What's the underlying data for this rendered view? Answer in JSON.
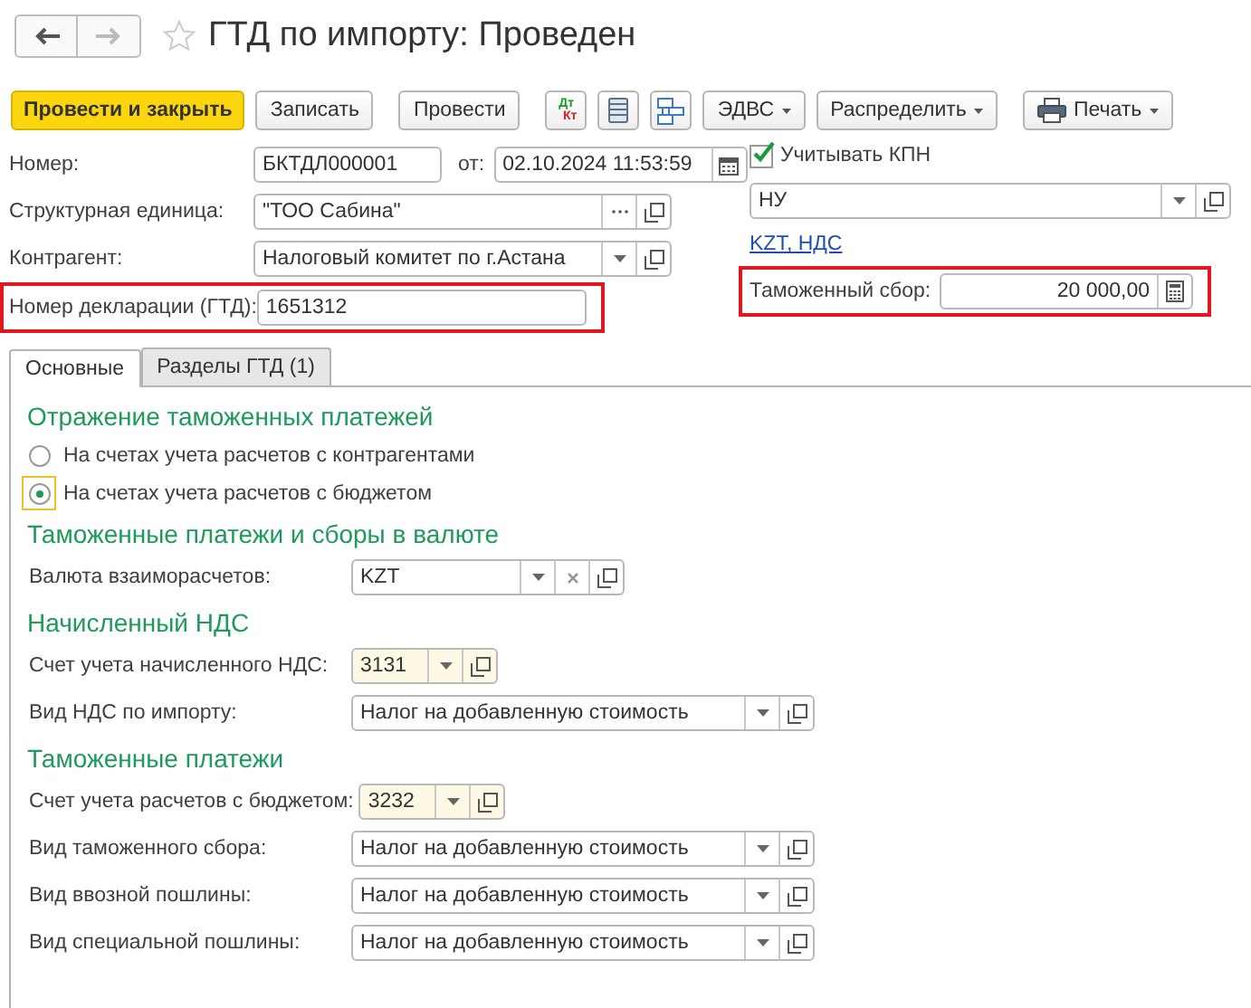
{
  "title": "ГТД по импорту: Проведен",
  "toolbar": [
    [
      {
        "kind": "button",
        "label": "Провести и закрыть",
        "primary": true
      },
      {
        "kind": "button",
        "label": "Записать",
        "primary": false
      }
    ],
    [
      {
        "kind": "button",
        "label": "Провести",
        "primary": false
      }
    ],
    [
      {
        "kind": "dtkt",
        "top": "Дт",
        "bottom": "Кт"
      },
      {
        "kind": "list"
      },
      {
        "kind": "structure"
      },
      {
        "kind": "menu",
        "label": "ЭДВС"
      },
      {
        "kind": "menu",
        "label": "Распределить"
      }
    ],
    [
      {
        "kind": "print",
        "label": "Печать"
      }
    ]
  ],
  "header": {
    "number": {
      "label": "Номер:",
      "value": "БКТДЛ000001"
    },
    "date": {
      "label": "от:",
      "value": "02.10.2024 11:53:59"
    },
    "unit": {
      "label": "Структурная единица:",
      "value": "\"ТОО Сабина\""
    },
    "counterparty": {
      "label": "Контрагент:",
      "value": "Налоговый комитет по г.Астана"
    },
    "declaration": {
      "label": "Номер декларации (ГТД):",
      "value": "1651312",
      "highlighted": true
    },
    "kpn": {
      "label": "Учитывать КПН",
      "checked": true
    },
    "accounting": {
      "value": "НУ"
    },
    "currency_link": "KZT, НДС",
    "customs_fee": {
      "label": "Таможенный сбор:",
      "value": "20 000,00",
      "highlighted": true
    }
  },
  "tabs": [
    {
      "label": "Основные",
      "selected": true
    },
    {
      "label": "Разделы ГТД (1)",
      "selected": false
    }
  ],
  "sections": [
    {
      "title": "Отражение таможенных платежей",
      "items": [
        {
          "kind": "radio",
          "label": "На счетах учета расчетов с контрагентами",
          "selected": false,
          "focused": false
        },
        {
          "kind": "radio",
          "label": "На счетах учета расчетов с бюджетом",
          "selected": true,
          "focused": true
        }
      ]
    },
    {
      "title": "Таможенные платежи и сборы в валюте",
      "items": [
        {
          "kind": "select",
          "label": "Валюта взаиморасчетов:",
          "value": "KZT",
          "clear": true
        }
      ]
    },
    {
      "title": "Начисленный НДС",
      "items": [
        {
          "kind": "account",
          "label": "Счет учета начисленного НДС:",
          "value": "3131"
        },
        {
          "kind": "select",
          "label": "Вид НДС по импорту:",
          "value": "Налог на добавленную стоимость",
          "clear": false
        }
      ]
    },
    {
      "title": "Таможенные платежи",
      "items": [
        {
          "kind": "account",
          "label": "Счет учета расчетов с бюджетом:",
          "value": "3232"
        },
        {
          "kind": "select",
          "label": "Вид таможенного сбора:",
          "value": "Налог на добавленную стоимость",
          "clear": false
        },
        {
          "kind": "select",
          "label": "Вид ввозной пошлины:",
          "value": "Налог на добавленную стоимость",
          "clear": false
        },
        {
          "kind": "select",
          "label": "Вид специальной пошлины:",
          "value": "Налог на добавленную стоимость",
          "clear": false
        }
      ]
    }
  ]
}
